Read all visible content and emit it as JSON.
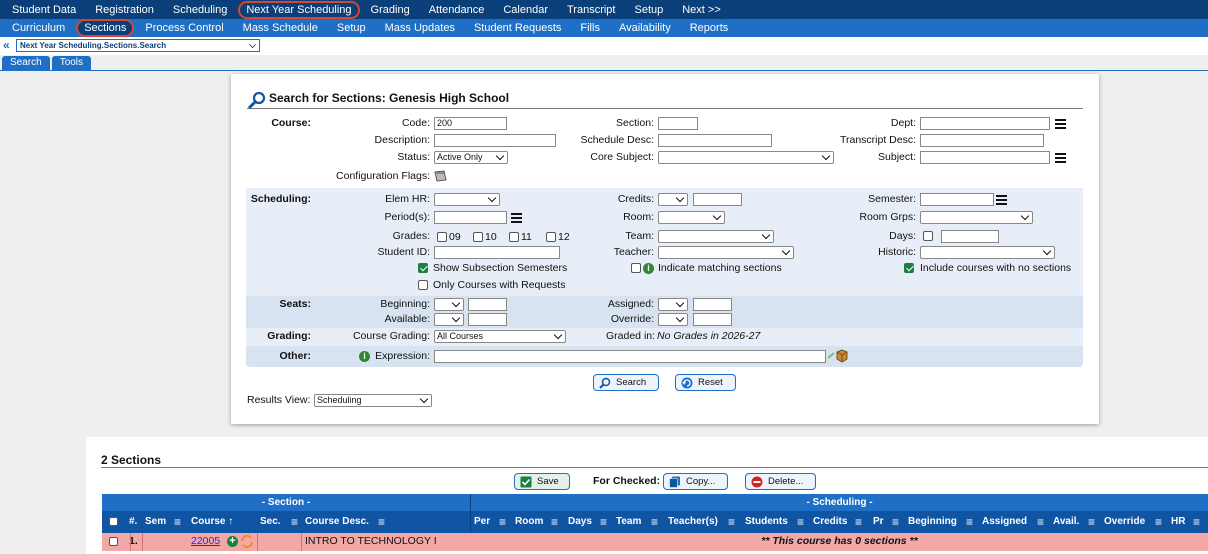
{
  "top_nav": [
    "Student Data",
    "Registration",
    "Scheduling",
    "Next Year Scheduling",
    "Grading",
    "Attendance",
    "Calendar",
    "Transcript",
    "Setup",
    "Next >>"
  ],
  "sub_nav": [
    "Curriculum",
    "Sections",
    "Process Control",
    "Mass Schedule",
    "Setup",
    "Mass Updates",
    "Student Requests",
    "Fills",
    "Availability",
    "Reports"
  ],
  "breadcrumb": {
    "arrow": "«",
    "value": "Next Year Scheduling.Sections.Search"
  },
  "tabs": [
    "Search",
    "Tools"
  ],
  "search": {
    "title": "Search for Sections: Genesis High School",
    "course_section": {
      "header": "Course:",
      "code_label": "Code:",
      "code_value": "200",
      "description_label": "Description:",
      "status_label": "Status:",
      "status_value": "Active Only",
      "config_label": "Configuration Flags:",
      "section_label": "Section:",
      "schedule_desc_label": "Schedule Desc:",
      "core_subject_label": "Core Subject:",
      "dept_label": "Dept:",
      "transcript_desc_label": "Transcript Desc:",
      "subject_label": "Subject:"
    },
    "scheduling_section": {
      "header": "Scheduling:",
      "elem_hr_label": "Elem HR:",
      "periods_label": "Period(s):",
      "grades_label": "Grades:",
      "grades": [
        "09",
        "10",
        "11",
        "12"
      ],
      "student_id_label": "Student ID:",
      "show_subsection": "Show Subsection Semesters",
      "only_requests": "Only Courses with Requests",
      "credits_label": "Credits:",
      "room_label": "Room:",
      "team_label": "Team:",
      "teacher_label": "Teacher:",
      "indicate_matching": "Indicate matching sections",
      "semester_label": "Semester:",
      "room_grps_label": "Room Grps:",
      "days_label": "Days:",
      "historic_label": "Historic:",
      "include_no_sections": "Include courses with no sections"
    },
    "seats_section": {
      "header": "Seats:",
      "beginning_label": "Beginning:",
      "available_label": "Available:",
      "assigned_label": "Assigned:",
      "override_label": "Override:"
    },
    "grading_section": {
      "header": "Grading:",
      "course_grading_label": "Course Grading:",
      "course_grading_value": "All Courses",
      "graded_in_label": "Graded in:",
      "graded_in_value": "No Grades in 2026-27"
    },
    "other_section": {
      "header": "Other:",
      "expression_label": "Expression:"
    },
    "search_button": "Search",
    "reset_button": "Reset",
    "results_view_label": "Results View:",
    "results_view_value": "Scheduling"
  },
  "results": {
    "title": "2 Sections",
    "save_button": "Save",
    "for_checked_label": "For Checked:",
    "copy_button": "Copy...",
    "delete_button": "Delete...",
    "group_section": "- Section -",
    "group_scheduling": "- Scheduling -",
    "columns_left": [
      "#.",
      "Sem",
      "Course ↑",
      "Sec.",
      "Course Desc."
    ],
    "columns_right": [
      "Per",
      "Room",
      "Days",
      "Team",
      "Teacher(s)",
      "Students",
      "Credits",
      "Pr",
      "Beginning",
      "Assigned",
      "Avail.",
      "Override",
      "HR"
    ],
    "rows": [
      {
        "num": "1.",
        "course": "22005",
        "desc": "INTRO TO TECHNOLOGY I",
        "message": "** This course has 0 sections **"
      }
    ]
  },
  "colors": {
    "nav_dark": "#0b3f7a",
    "nav_blue": "#1e6fc5",
    "highlight_circle": "#d9452e",
    "row_warning": "#f3a8a8"
  }
}
